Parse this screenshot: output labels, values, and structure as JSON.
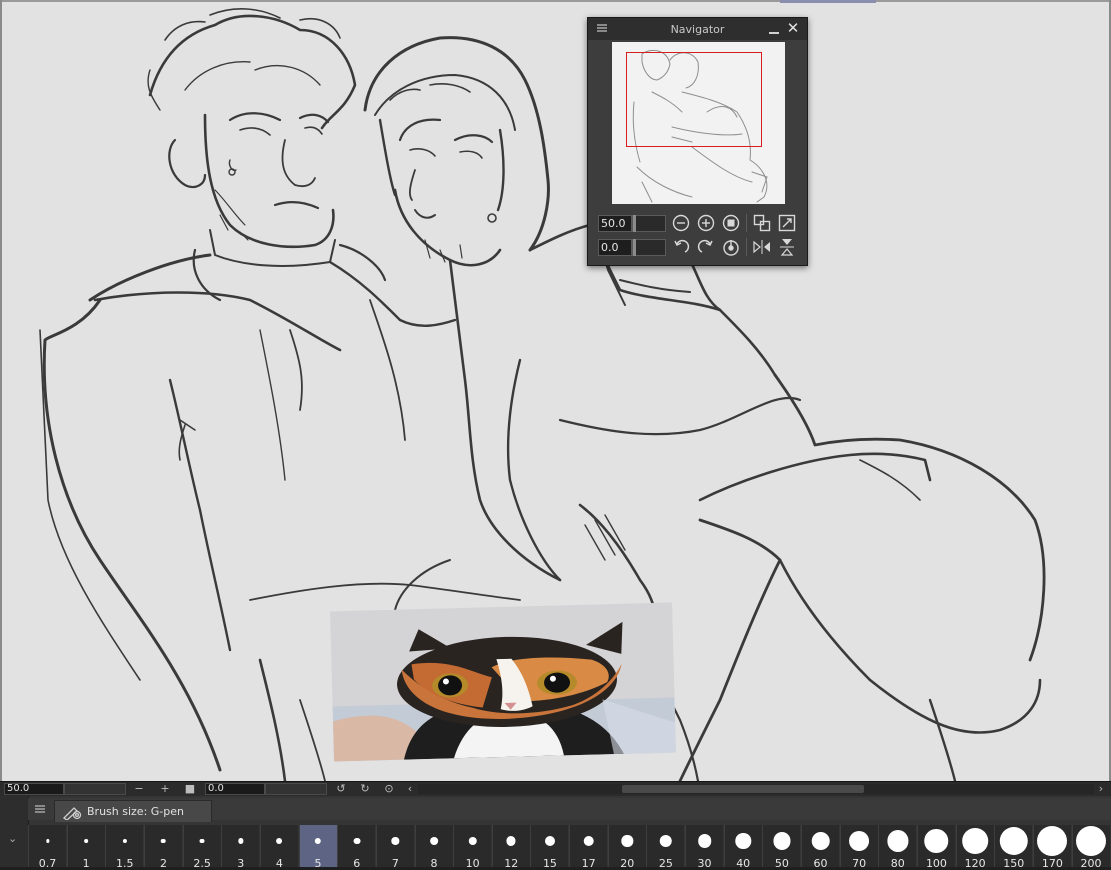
{
  "navigator": {
    "title": "Navigator",
    "zoom_value": "50.0",
    "rotation_value": "0.0"
  },
  "statusbar": {
    "zoom_value": "50.0",
    "rotation_value": "0.0",
    "minus_label": "−",
    "plus_label": "+",
    "left_arrow": "‹",
    "right_arrow": "›"
  },
  "brush_panel": {
    "tab_label": "Brush size: G-pen",
    "selected_size": "5",
    "sizes": [
      "0.7",
      "1",
      "1.5",
      "2",
      "2.5",
      "3",
      "4",
      "5",
      "6",
      "7",
      "8",
      "10",
      "12",
      "15",
      "17",
      "20",
      "25",
      "30",
      "40",
      "50",
      "60",
      "70",
      "80",
      "100",
      "120",
      "150",
      "170",
      "200"
    ]
  },
  "colors": {
    "canvas_bg": "#e2e2e2",
    "panel_bg": "#3d3d3d",
    "selected_cell": "#5d6484",
    "navigator_frame": "#d61e1e"
  }
}
